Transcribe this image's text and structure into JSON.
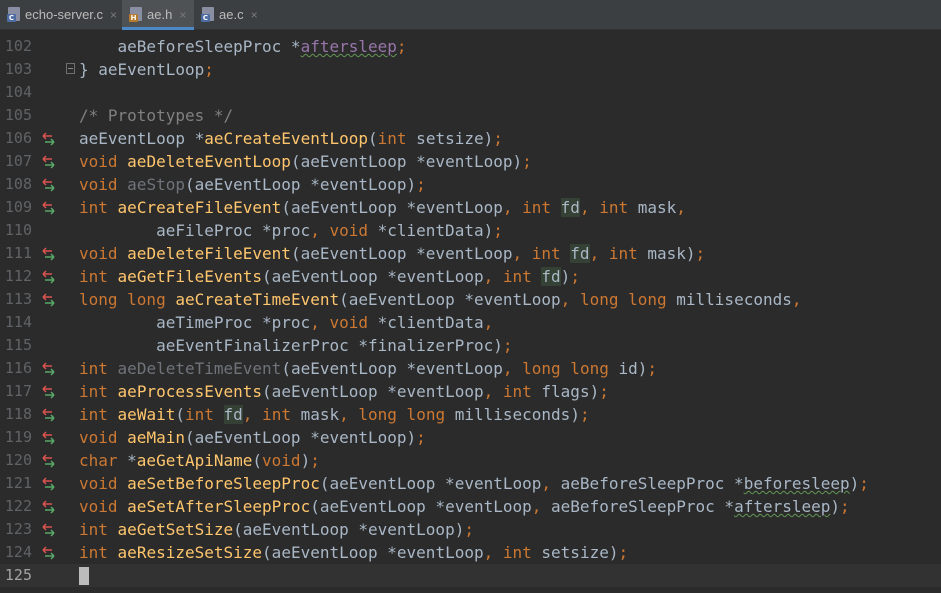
{
  "tabs": [
    {
      "name": "echo-server.c",
      "badge": "C",
      "badge_color": "#4d6ba3",
      "active": false
    },
    {
      "name": "ae.h",
      "badge": "H",
      "badge_color": "#b57a2c",
      "active": true
    },
    {
      "name": "ae.c",
      "badge": "C",
      "badge_color": "#4d6ba3",
      "active": false
    }
  ],
  "close_glyph": "×",
  "colors": {
    "background": "#2b2b2b",
    "keyword": "#cc7832",
    "function": "#ffc66d",
    "comment": "#808080",
    "parameter": "#9876aa",
    "text": "#a9b7c6",
    "gutter_up": "#d9534f",
    "gutter_down": "#59a869"
  },
  "gutter_icon": "implementation-arrows-icon",
  "cursor_line": 125,
  "lines": [
    {
      "n": 102,
      "icon": false,
      "fold": false,
      "tokens": [
        {
          "t": "    aeBeforeSleepProc *",
          "c": ""
        },
        {
          "t": "aftersleep",
          "c": "par ud"
        },
        {
          "t": ";",
          "c": "kw"
        }
      ]
    },
    {
      "n": 103,
      "icon": false,
      "fold": true,
      "tokens": [
        {
          "t": "} aeEventLoop",
          "c": ""
        },
        {
          "t": ";",
          "c": "kw"
        }
      ]
    },
    {
      "n": 104,
      "icon": false,
      "fold": false,
      "tokens": []
    },
    {
      "n": 105,
      "icon": false,
      "fold": false,
      "tokens": [
        {
          "t": "/* Prototypes */",
          "c": "cm"
        }
      ]
    },
    {
      "n": 106,
      "icon": true,
      "fold": false,
      "tokens": [
        {
          "t": "aeEventLoop *",
          "c": ""
        },
        {
          "t": "aeCreateEventLoop",
          "c": "fn"
        },
        {
          "t": "(",
          "c": ""
        },
        {
          "t": "int",
          "c": "kw"
        },
        {
          "t": " setsize)",
          "c": ""
        },
        {
          "t": ";",
          "c": "kw"
        }
      ]
    },
    {
      "n": 107,
      "icon": true,
      "fold": false,
      "tokens": [
        {
          "t": "void",
          "c": "kw"
        },
        {
          "t": " ",
          "c": ""
        },
        {
          "t": "aeDeleteEventLoop",
          "c": "fn"
        },
        {
          "t": "(aeEventLoop *eventLoop)",
          "c": ""
        },
        {
          "t": ";",
          "c": "kw"
        }
      ]
    },
    {
      "n": 108,
      "icon": true,
      "fold": false,
      "tokens": [
        {
          "t": "void",
          "c": "kw"
        },
        {
          "t": " ",
          "c": ""
        },
        {
          "t": "aeStop",
          "c": "fn-gray"
        },
        {
          "t": "(aeEventLoop *eventLoop)",
          "c": ""
        },
        {
          "t": ";",
          "c": "kw"
        }
      ]
    },
    {
      "n": 109,
      "icon": true,
      "fold": false,
      "tokens": [
        {
          "t": "int",
          "c": "kw"
        },
        {
          "t": " ",
          "c": ""
        },
        {
          "t": "aeCreateFileEvent",
          "c": "fn"
        },
        {
          "t": "(aeEventLoop *eventLoop",
          "c": ""
        },
        {
          "t": ", int ",
          "c": "kw"
        },
        {
          "t": "fd",
          "c": "hl"
        },
        {
          "t": ", int ",
          "c": "kw"
        },
        {
          "t": "mask",
          "c": ""
        },
        {
          "t": ",",
          "c": "kw"
        }
      ]
    },
    {
      "n": 110,
      "icon": false,
      "fold": false,
      "tokens": [
        {
          "t": "        aeFileProc *proc",
          "c": ""
        },
        {
          "t": ", void ",
          "c": "kw"
        },
        {
          "t": "*clientData)",
          "c": ""
        },
        {
          "t": ";",
          "c": "kw"
        }
      ]
    },
    {
      "n": 111,
      "icon": true,
      "fold": false,
      "tokens": [
        {
          "t": "void",
          "c": "kw"
        },
        {
          "t": " ",
          "c": ""
        },
        {
          "t": "aeDeleteFileEvent",
          "c": "fn"
        },
        {
          "t": "(aeEventLoop *eventLoop",
          "c": ""
        },
        {
          "t": ", int ",
          "c": "kw"
        },
        {
          "t": "fd",
          "c": "hl"
        },
        {
          "t": ", int ",
          "c": "kw"
        },
        {
          "t": "mask)",
          "c": ""
        },
        {
          "t": ";",
          "c": "kw"
        }
      ]
    },
    {
      "n": 112,
      "icon": true,
      "fold": false,
      "tokens": [
        {
          "t": "int",
          "c": "kw"
        },
        {
          "t": " ",
          "c": ""
        },
        {
          "t": "aeGetFileEvents",
          "c": "fn"
        },
        {
          "t": "(aeEventLoop *eventLoop",
          "c": ""
        },
        {
          "t": ", int ",
          "c": "kw"
        },
        {
          "t": "fd",
          "c": "hl"
        },
        {
          "t": ")",
          "c": ""
        },
        {
          "t": ";",
          "c": "kw"
        }
      ]
    },
    {
      "n": 113,
      "icon": true,
      "fold": false,
      "tokens": [
        {
          "t": "long long",
          "c": "kw"
        },
        {
          "t": " ",
          "c": ""
        },
        {
          "t": "aeCreateTimeEvent",
          "c": "fn"
        },
        {
          "t": "(aeEventLoop *eventLoop",
          "c": ""
        },
        {
          "t": ", long long ",
          "c": "kw"
        },
        {
          "t": "milliseconds",
          "c": ""
        },
        {
          "t": ",",
          "c": "kw"
        }
      ]
    },
    {
      "n": 114,
      "icon": false,
      "fold": false,
      "tokens": [
        {
          "t": "        aeTimeProc *proc",
          "c": ""
        },
        {
          "t": ", void ",
          "c": "kw"
        },
        {
          "t": "*clientData",
          "c": ""
        },
        {
          "t": ",",
          "c": "kw"
        }
      ]
    },
    {
      "n": 115,
      "icon": false,
      "fold": false,
      "tokens": [
        {
          "t": "        aeEventFinalizerProc *finalizerProc)",
          "c": ""
        },
        {
          "t": ";",
          "c": "kw"
        }
      ]
    },
    {
      "n": 116,
      "icon": true,
      "fold": false,
      "tokens": [
        {
          "t": "int",
          "c": "kw"
        },
        {
          "t": " ",
          "c": ""
        },
        {
          "t": "aeDeleteTimeEvent",
          "c": "fn-gray"
        },
        {
          "t": "(aeEventLoop *eventLoop",
          "c": ""
        },
        {
          "t": ", long long ",
          "c": "kw"
        },
        {
          "t": "id)",
          "c": ""
        },
        {
          "t": ";",
          "c": "kw"
        }
      ]
    },
    {
      "n": 117,
      "icon": true,
      "fold": false,
      "tokens": [
        {
          "t": "int",
          "c": "kw"
        },
        {
          "t": " ",
          "c": ""
        },
        {
          "t": "aeProcessEvents",
          "c": "fn"
        },
        {
          "t": "(aeEventLoop *eventLoop",
          "c": ""
        },
        {
          "t": ", int ",
          "c": "kw"
        },
        {
          "t": "flags)",
          "c": ""
        },
        {
          "t": ";",
          "c": "kw"
        }
      ]
    },
    {
      "n": 118,
      "icon": true,
      "fold": false,
      "tokens": [
        {
          "t": "int",
          "c": "kw"
        },
        {
          "t": " ",
          "c": ""
        },
        {
          "t": "aeWait",
          "c": "fn"
        },
        {
          "t": "(",
          "c": ""
        },
        {
          "t": "int",
          "c": "kw"
        },
        {
          "t": " ",
          "c": ""
        },
        {
          "t": "fd",
          "c": "hl"
        },
        {
          "t": ", int ",
          "c": "kw"
        },
        {
          "t": "mask",
          "c": ""
        },
        {
          "t": ", long long ",
          "c": "kw"
        },
        {
          "t": "milliseconds)",
          "c": ""
        },
        {
          "t": ";",
          "c": "kw"
        }
      ]
    },
    {
      "n": 119,
      "icon": true,
      "fold": false,
      "tokens": [
        {
          "t": "void",
          "c": "kw"
        },
        {
          "t": " ",
          "c": ""
        },
        {
          "t": "aeMain",
          "c": "fn"
        },
        {
          "t": "(aeEventLoop *eventLoop)",
          "c": ""
        },
        {
          "t": ";",
          "c": "kw"
        }
      ]
    },
    {
      "n": 120,
      "icon": true,
      "fold": false,
      "tokens": [
        {
          "t": "char",
          "c": "kw"
        },
        {
          "t": " *",
          "c": ""
        },
        {
          "t": "aeGetApiName",
          "c": "fn"
        },
        {
          "t": "(",
          "c": ""
        },
        {
          "t": "void",
          "c": "kw"
        },
        {
          "t": ")",
          "c": ""
        },
        {
          "t": ";",
          "c": "kw"
        }
      ]
    },
    {
      "n": 121,
      "icon": true,
      "fold": false,
      "tokens": [
        {
          "t": "void",
          "c": "kw"
        },
        {
          "t": " ",
          "c": ""
        },
        {
          "t": "aeSetBeforeSleepProc",
          "c": "fn"
        },
        {
          "t": "(aeEventLoop *eventLoop",
          "c": ""
        },
        {
          "t": ", ",
          "c": "kw"
        },
        {
          "t": "aeBeforeSleepProc *",
          "c": ""
        },
        {
          "t": "beforesleep",
          "c": "ud"
        },
        {
          "t": ")",
          "c": ""
        },
        {
          "t": ";",
          "c": "kw"
        }
      ]
    },
    {
      "n": 122,
      "icon": true,
      "fold": false,
      "tokens": [
        {
          "t": "void",
          "c": "kw"
        },
        {
          "t": " ",
          "c": ""
        },
        {
          "t": "aeSetAfterSleepProc",
          "c": "fn"
        },
        {
          "t": "(aeEventLoop *eventLoop",
          "c": ""
        },
        {
          "t": ", ",
          "c": "kw"
        },
        {
          "t": "aeBeforeSleepProc *",
          "c": ""
        },
        {
          "t": "aftersleep",
          "c": "ud"
        },
        {
          "t": ")",
          "c": ""
        },
        {
          "t": ";",
          "c": "kw"
        }
      ]
    },
    {
      "n": 123,
      "icon": true,
      "fold": false,
      "tokens": [
        {
          "t": "int",
          "c": "kw"
        },
        {
          "t": " ",
          "c": ""
        },
        {
          "t": "aeGetSetSize",
          "c": "fn"
        },
        {
          "t": "(aeEventLoop *eventLoop)",
          "c": ""
        },
        {
          "t": ";",
          "c": "kw"
        }
      ]
    },
    {
      "n": 124,
      "icon": true,
      "fold": false,
      "tokens": [
        {
          "t": "int",
          "c": "kw"
        },
        {
          "t": " ",
          "c": ""
        },
        {
          "t": "aeResizeSetSize",
          "c": "fn"
        },
        {
          "t": "(aeEventLoop *eventLoop",
          "c": ""
        },
        {
          "t": ", int ",
          "c": "kw"
        },
        {
          "t": "setsize)",
          "c": ""
        },
        {
          "t": ";",
          "c": "kw"
        }
      ]
    },
    {
      "n": 125,
      "icon": false,
      "fold": false,
      "tokens": []
    }
  ]
}
